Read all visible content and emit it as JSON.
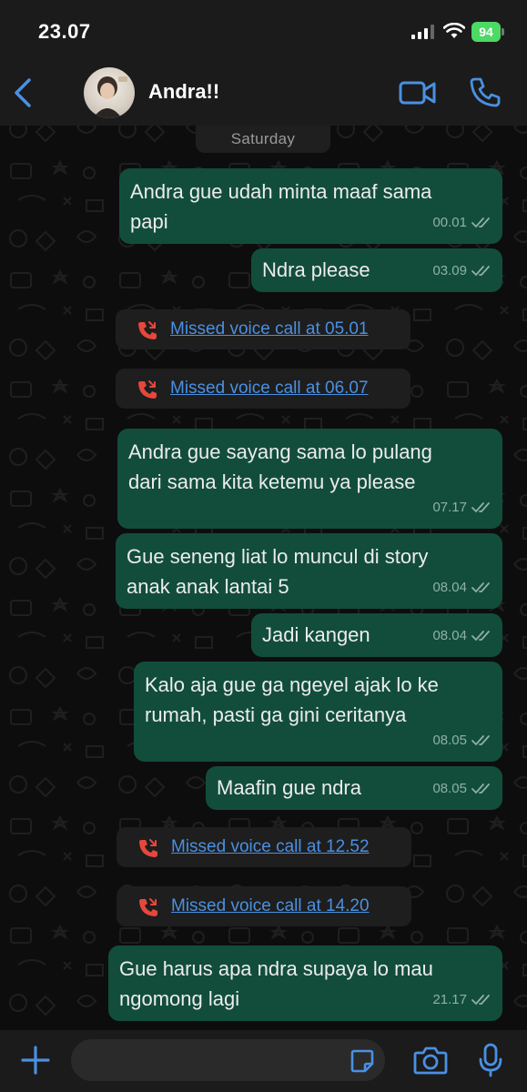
{
  "status_bar": {
    "time": "23.07",
    "battery": "94"
  },
  "header": {
    "contact_name": "Andra!!"
  },
  "date_label": "Saturday",
  "messages": [
    {
      "text_lines": [
        "Andra gue udah minta maaf sama",
        "papi"
      ],
      "time": "00.01"
    },
    {
      "text_lines": [
        "Ndra please"
      ],
      "time": "03.09"
    },
    {
      "text_lines": [
        "Andra gue sayang sama lo pulang",
        "dari sama kita ketemu ya please"
      ],
      "time": "07.17"
    },
    {
      "text_lines": [
        "Gue seneng liat lo muncul di story",
        "anak anak lantai 5"
      ],
      "time": "08.04"
    },
    {
      "text_lines": [
        "Jadi kangen"
      ],
      "time": "08.04"
    },
    {
      "text_lines": [
        "Kalo aja gue ga ngeyel ajak lo ke",
        "rumah, pasti ga gini ceritanya"
      ],
      "time": "08.05"
    },
    {
      "text_lines": [
        "Maafin gue ndra"
      ],
      "time": "08.05"
    },
    {
      "text_lines": [
        "Gue harus apa ndra supaya lo mau",
        "ngomong lagi"
      ],
      "time": "21.17"
    }
  ],
  "missed_calls": [
    {
      "label": "Missed voice call at 05.01"
    },
    {
      "label": "Missed voice call at 06.07"
    },
    {
      "label": "Missed voice call at 12.52"
    },
    {
      "label": "Missed voice call at 14.20"
    }
  ],
  "colors": {
    "outgoing_bubble": "#124d3c",
    "accent": "#4a90e2",
    "missed_call_icon": "#e5483b",
    "battery": "#4cd964"
  },
  "icons": {
    "back": "chevron-left-icon",
    "video": "video-camera-icon",
    "phone": "phone-icon",
    "missed_call": "missed-call-icon",
    "read_ticks": "double-check-icon",
    "attach": "plus-icon",
    "sticker": "sticker-icon",
    "camera": "camera-icon",
    "mic": "microphone-icon"
  }
}
